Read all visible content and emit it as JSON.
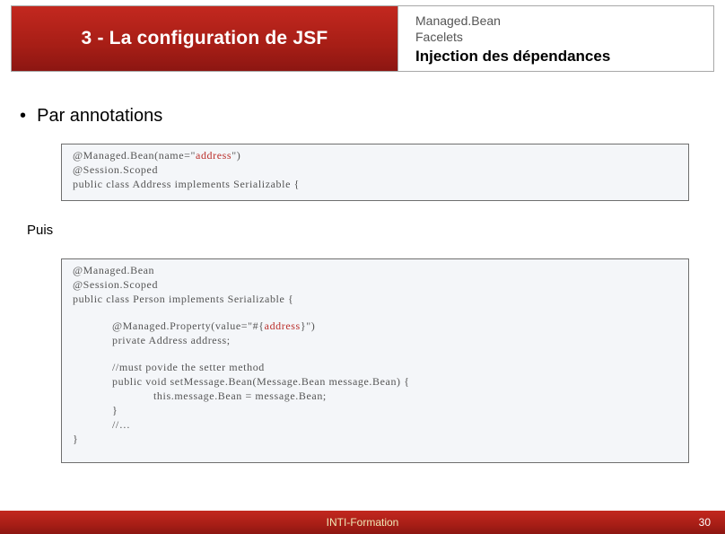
{
  "header": {
    "left_title": "3 - La configuration de JSF",
    "right_line1": "Managed.Bean",
    "right_line2": "Facelets",
    "right_line3": "Injection des dépendances"
  },
  "body": {
    "bullet": "Par annotations",
    "puis": "Puis",
    "code1": {
      "l1a": "@Managed.Bean(name=\"",
      "l1b": "address",
      "l1c": "\")",
      "l2": "@Session.Scoped",
      "l3": "public class Address implements Serializable {"
    },
    "code2": {
      "l1": "@Managed.Bean",
      "l2": "@Session.Scoped",
      "l3": "public class Person implements Serializable {",
      "l4a": "@Managed.Property(value=\"#{",
      "l4b": "address",
      "l4c": "}\")",
      "l5": "private Address address;",
      "l6": "//must povide the setter method",
      "l7": "public void setMessage.Bean(Message.Bean message.Bean) {",
      "l8": "this.message.Bean = message.Bean;",
      "l9": "}",
      "l10": "//…",
      "l11": "}"
    }
  },
  "footer": {
    "center": "INTI-Formation",
    "page": "30"
  }
}
